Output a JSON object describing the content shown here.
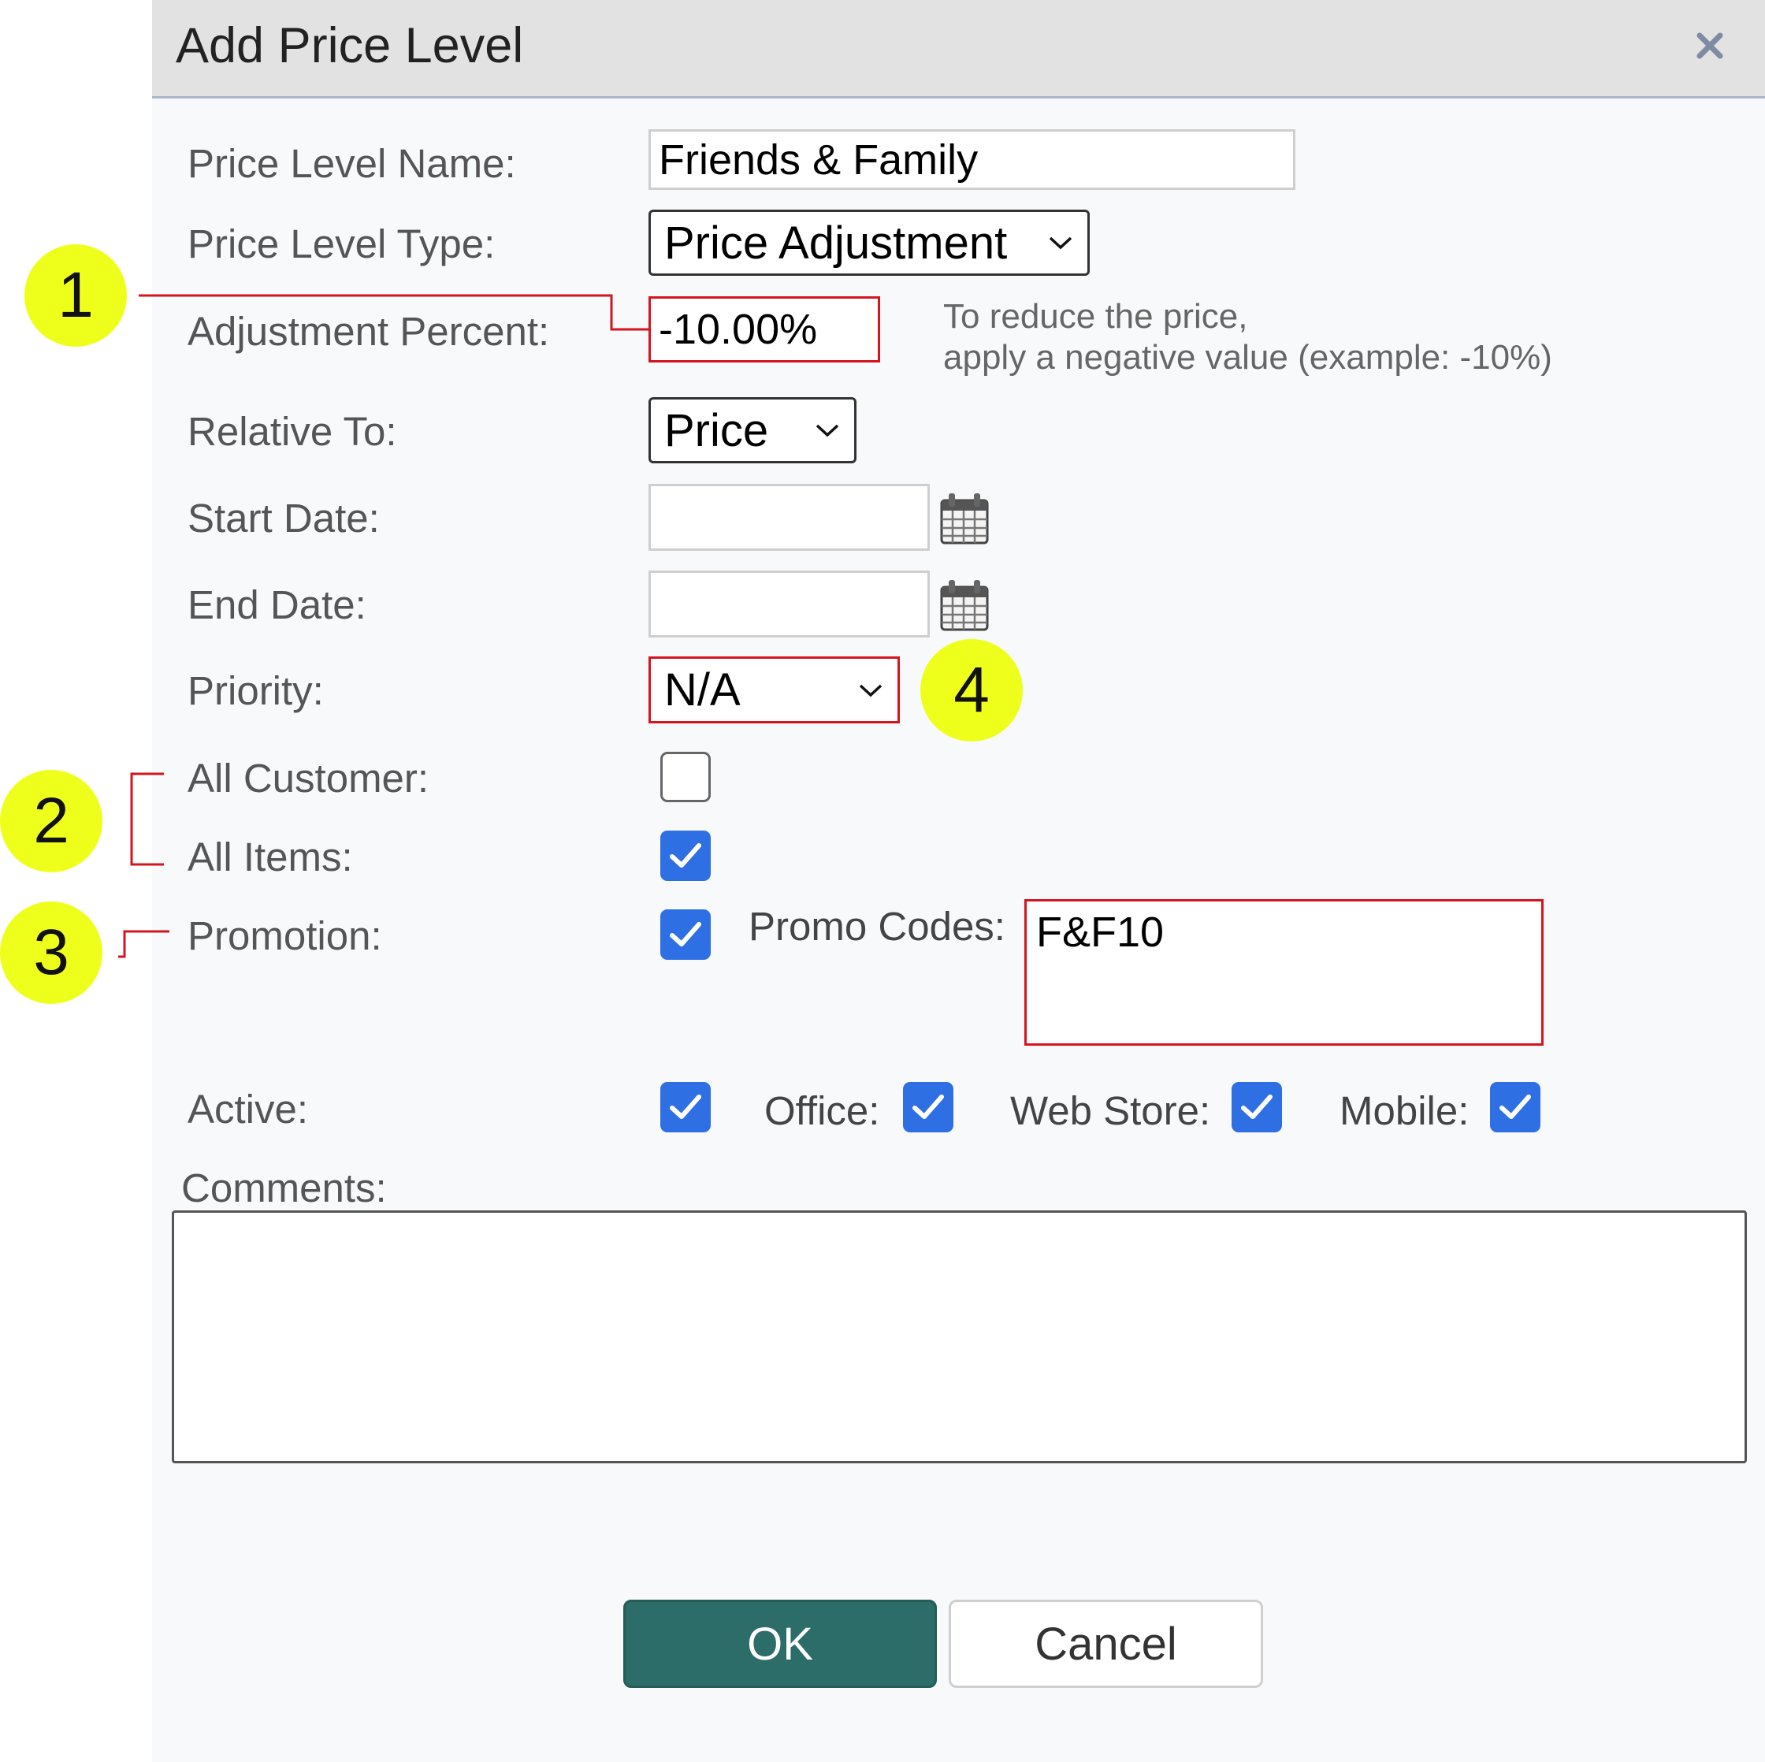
{
  "dialog": {
    "title": "Add Price Level"
  },
  "form": {
    "name_label": "Price Level Name:",
    "name_value": "Friends & Family",
    "type_label": "Price Level Type:",
    "type_value": "Price Adjustment",
    "adjustment_label": "Adjustment Percent:",
    "adjustment_value": "-10.00%",
    "adjustment_hint_line1": "To reduce the price,",
    "adjustment_hint_line2": "apply a negative value (example: -10%)",
    "relative_label": "Relative To:",
    "relative_value": "Price",
    "start_label": "Start Date:",
    "start_value": "",
    "end_label": "End Date:",
    "end_value": "",
    "priority_label": "Priority:",
    "priority_value": "N/A",
    "all_customer_label": "All Customer:",
    "all_customer_checked": false,
    "all_items_label": "All Items:",
    "all_items_checked": true,
    "promotion_label": "Promotion:",
    "promotion_checked": true,
    "promo_codes_label": "Promo Codes:",
    "promo_codes_value": "F&F10",
    "active_label": "Active:",
    "active_checked": true,
    "office_label": "Office:",
    "office_checked": true,
    "webstore_label": "Web Store:",
    "webstore_checked": true,
    "mobile_label": "Mobile:",
    "mobile_checked": true,
    "comments_label": "Comments:",
    "comments_value": ""
  },
  "buttons": {
    "ok": "OK",
    "cancel": "Cancel"
  },
  "annotations": {
    "badge_1": "1",
    "badge_2": "2",
    "badge_3": "3",
    "badge_4": "4",
    "badge_color": "#efff1c",
    "highlight_color": "#d4141e"
  },
  "colors": {
    "checkbox_checked": "#2f6fe4",
    "ok_button": "#2d6d69",
    "titlebar": "#e2e2e2"
  },
  "icons": [
    "close-icon",
    "calendar-icon",
    "chevron-down-icon",
    "checkmark-icon"
  ]
}
